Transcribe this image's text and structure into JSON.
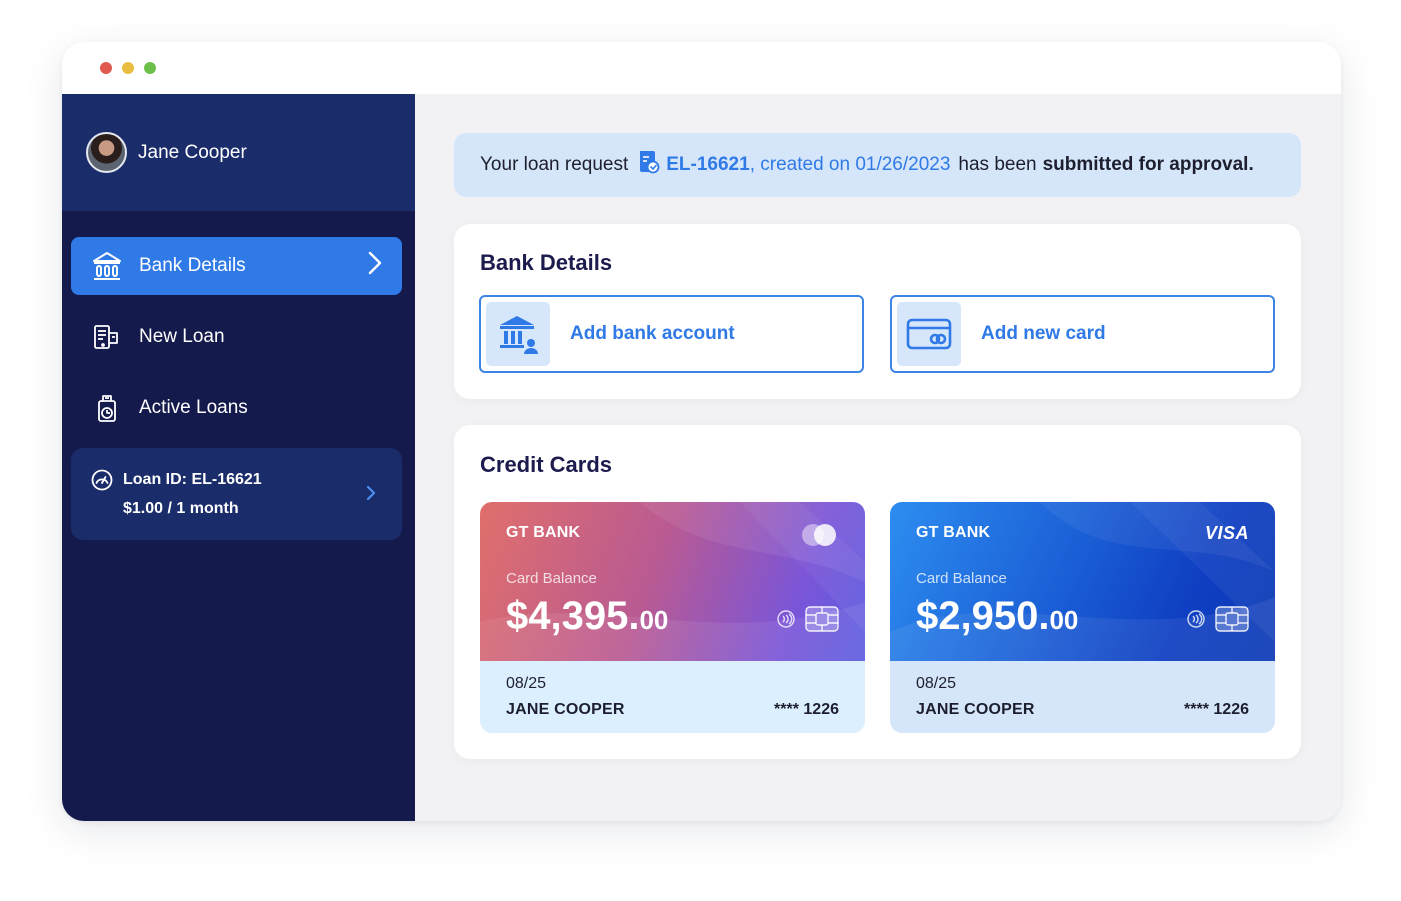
{
  "window": {
    "controls": [
      "close",
      "minimize",
      "maximize"
    ]
  },
  "profile": {
    "name": "Jane Cooper"
  },
  "sidebar": {
    "items": [
      {
        "label": "Bank Details",
        "icon": "bank-icon",
        "active": true
      },
      {
        "label": "New Loan",
        "icon": "new-loan-icon",
        "active": false
      },
      {
        "label": "Active Loans",
        "icon": "active-loans-icon",
        "active": false
      }
    ],
    "loan": {
      "id_label": "Loan ID: EL-16621",
      "amount_label": "$1.00 / 1 month"
    }
  },
  "notice": {
    "prefix": "Your loan request",
    "ref": "EL-16621",
    "created": ", created on 01/26/2023",
    "middle": "has been",
    "status": "submitted for approval."
  },
  "bank_details": {
    "title": "Bank Details",
    "add_account": "Add bank account",
    "add_card": "Add new card"
  },
  "credit_cards": {
    "title": "Credit Cards",
    "cards": [
      {
        "bank": "GT BANK",
        "balance_label": "Card Balance",
        "balance_main": "$4,395.",
        "balance_cents": "00",
        "brand": "mastercard",
        "expiry": "08/25",
        "holder": "JANE COOPER",
        "number": "**** 1226"
      },
      {
        "bank": "GT BANK",
        "balance_label": "Card Balance",
        "balance_main": "$2,950.",
        "balance_cents": "00",
        "brand": "VISA",
        "expiry": "08/25",
        "holder": "JANE COOPER",
        "number": "**** 1226"
      }
    ]
  },
  "colors": {
    "sidebar_bg": "#141a4b",
    "profile_bg": "#1b2c6b",
    "accent": "#2f7ae6",
    "notice_bg": "#d6e6fa"
  }
}
